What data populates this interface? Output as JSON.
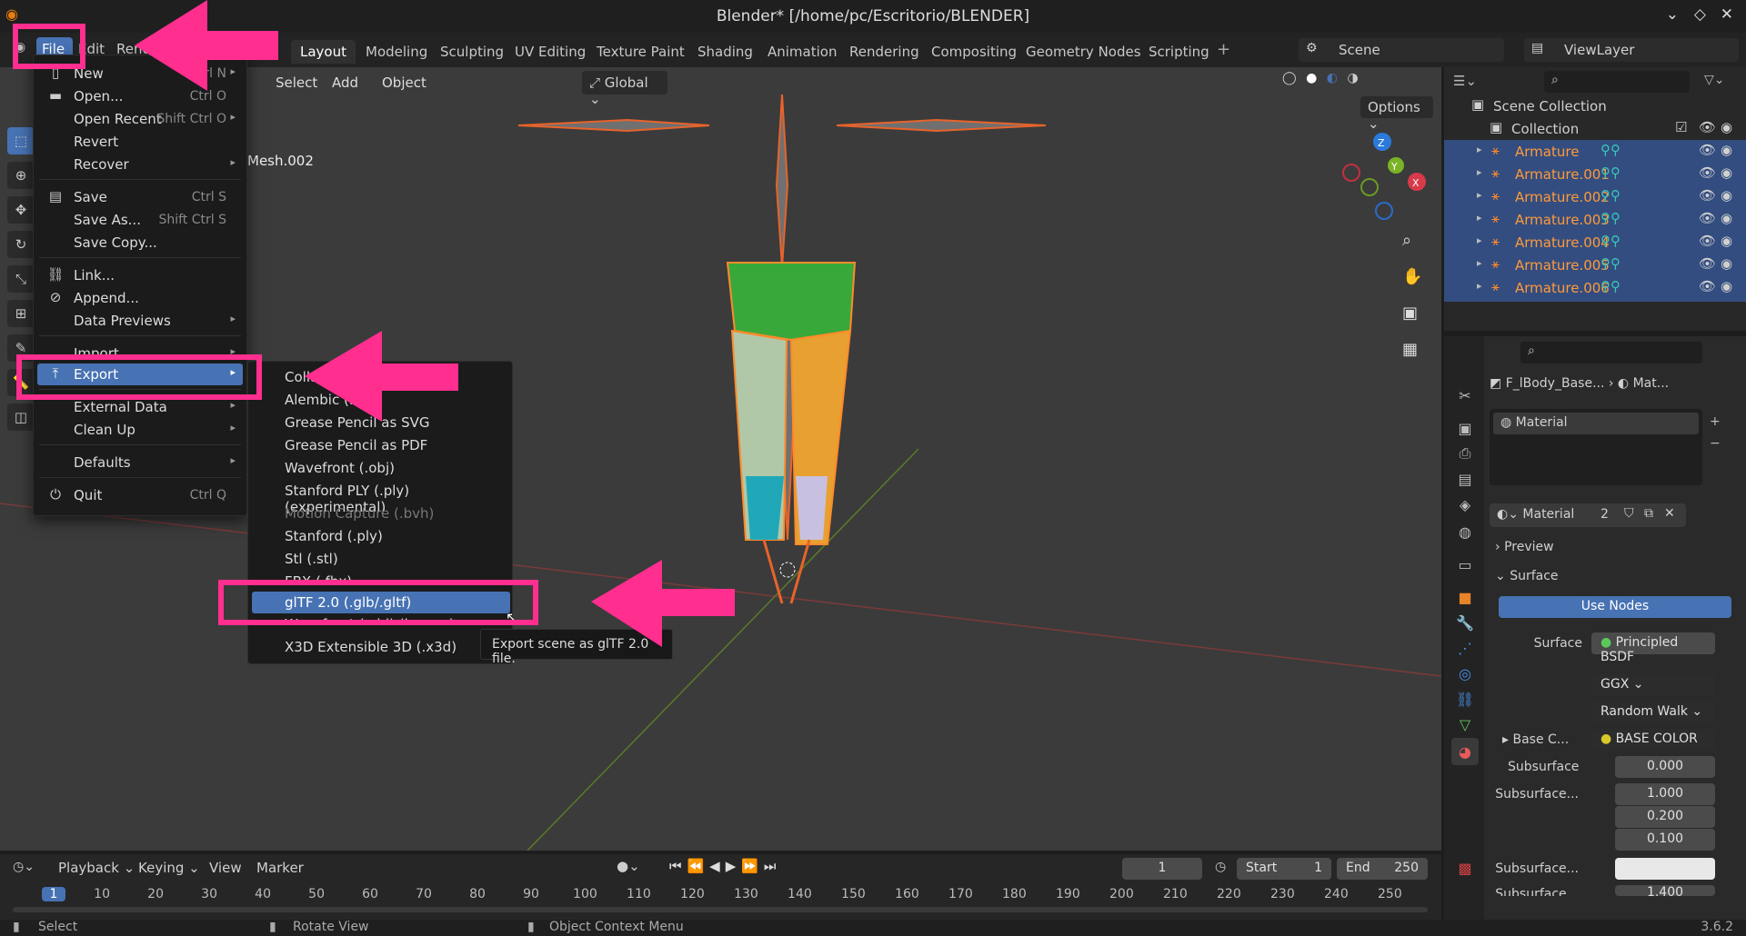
{
  "title": "Blender* [/home/pc/Escritorio/BLENDER]",
  "menubar": {
    "file": "File",
    "edit": "Edit",
    "render": "Render"
  },
  "workspaces": [
    "Layout",
    "Modeling",
    "Sculpting",
    "UV Editing",
    "Texture Paint",
    "Shading",
    "Animation",
    "Rendering",
    "Compositing",
    "Geometry Nodes",
    "Scripting"
  ],
  "scene_label": "Scene",
  "viewlayer_label": "ViewLayer",
  "viewport": {
    "header": [
      "Select",
      "Add",
      "Object"
    ],
    "orientation": "Global",
    "options": "Options",
    "object_label": "Mesh.002"
  },
  "file_menu": [
    {
      "label": "New",
      "shortcut": "Ctrl N",
      "icon": "new-file-icon",
      "arrow": true
    },
    {
      "label": "Open...",
      "shortcut": "Ctrl O",
      "icon": "folder-icon"
    },
    {
      "label": "Open Recent",
      "shortcut": "Shift Ctrl O",
      "arrow": true
    },
    {
      "label": "Revert"
    },
    {
      "label": "Recover",
      "arrow": true
    },
    {
      "label": "Save",
      "shortcut": "Ctrl S",
      "icon": "save-icon"
    },
    {
      "label": "Save As...",
      "shortcut": "Shift Ctrl S"
    },
    {
      "label": "Save Copy..."
    },
    {
      "label": "Link...",
      "icon": "link-icon"
    },
    {
      "label": "Append...",
      "icon": "append-icon"
    },
    {
      "label": "Data Previews",
      "arrow": true
    },
    {
      "label": "Import",
      "arrow": true
    },
    {
      "label": "Export",
      "arrow": true,
      "icon": "export-icon",
      "highlight": true
    },
    {
      "label": "External Data",
      "arrow": true
    },
    {
      "label": "Clean Up",
      "arrow": true
    },
    {
      "label": "Defaults",
      "arrow": true
    },
    {
      "label": "Quit",
      "shortcut": "Ctrl Q",
      "icon": "power-icon"
    }
  ],
  "export_menu": [
    "Collada (.dae)",
    "Alembic (.abc)",
    "Grease Pencil as SVG",
    "Grease Pencil as PDF",
    "Wavefront (.obj)",
    "Stanford PLY (.ply) (experimental)",
    "Motion Capture (.bvh)",
    "Stanford (.ply)",
    "Stl (.stl)",
    "FBX (.fbx)",
    "glTF 2.0 (.glb/.gltf)",
    "Wavefront (.obj) (legacy)",
    "X3D Extensible 3D (.x3d)"
  ],
  "tooltip": "Export scene as glTF 2.0 file.",
  "outliner": {
    "scene_collection": "Scene Collection",
    "collection": "Collection",
    "items": [
      "Armature",
      "Armature.001",
      "Armature.002",
      "Armature.003",
      "Armature.004",
      "Armature.005",
      "Armature.006"
    ]
  },
  "properties": {
    "breadcrumb_obj": "F_lBody_Base...",
    "breadcrumb_mat": "Mat...",
    "material_slot": "Material",
    "material_name": "Material",
    "users": "2",
    "preview": "Preview",
    "surface_section": "Surface",
    "use_nodes": "Use Nodes",
    "surface_label": "Surface",
    "surface_value": "Principled BSDF",
    "distribution": "GGX",
    "subsurface_method": "Random Walk",
    "base_color_label": "Base C...",
    "base_color_value": "BASE COLOR",
    "subsurface_label": "Subsurface",
    "subsurface_value": "0.000",
    "subsurface_radius_label": "Subsurface...",
    "radius": [
      "1.000",
      "0.200",
      "0.100"
    ],
    "subsurface_color_label": "Subsurface...",
    "subsurface_ior_label": "Subsurface...",
    "subsurface_ior_value": "1.400"
  },
  "timeline": {
    "playback": "Playback",
    "keying": "Keying",
    "view": "View",
    "marker": "Marker",
    "current_frame": "1",
    "start_label": "Start",
    "start": "1",
    "end_label": "End",
    "end": "250",
    "frames": [
      "1",
      "10",
      "20",
      "30",
      "40",
      "50",
      "60",
      "70",
      "80",
      "90",
      "100",
      "110",
      "120",
      "130",
      "140",
      "150",
      "160",
      "170",
      "180",
      "190",
      "200",
      "210",
      "220",
      "230",
      "240",
      "250"
    ]
  },
  "status": {
    "select": "Select",
    "rotate": "Rotate View",
    "context": "Object Context Menu",
    "version": "3.6.2"
  },
  "accent": "#4772b3",
  "highlight_color": "#ff2e8f"
}
